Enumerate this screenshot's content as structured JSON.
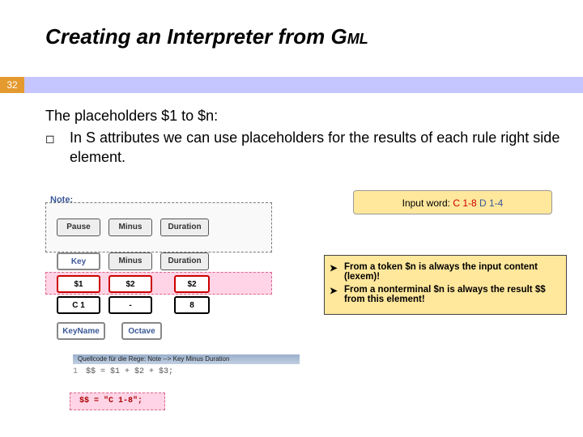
{
  "slide": {
    "page_number": "32",
    "title_main": "Creating an Interpreter from G",
    "title_sub": "ML"
  },
  "body": {
    "heading": "The placeholders $1 to $n:",
    "bullet_icon": "◻",
    "bullet_text": "In S attributes we can use placeholders for the results of each rule right side element."
  },
  "input_word": {
    "label": "Input word: ",
    "part1": "C 1-8",
    "part2": " D 1-4"
  },
  "notes": {
    "arrow": "➤",
    "line1": "From a token $n is always the input content (lexem)!",
    "line2": "From a nonterminal $n is always the result $$ from this element!"
  },
  "diagram": {
    "note_label": "Note:",
    "pause": "Pause",
    "minus": "Minus",
    "duration": "Duration",
    "key": "Key",
    "ph1": "$1",
    "ph2": "$2",
    "c1": "C 1",
    "dash": "-",
    "eight": "8",
    "keyname": "KeyName",
    "octave": "Octave",
    "quellcode_label": "Quellcode für die Rege: Note --> Key Minus Duration",
    "code_line_num": "1",
    "code_line": "$$ = $1 + $2 + $3;",
    "result": "$$  =  \"C 1-8\";"
  }
}
